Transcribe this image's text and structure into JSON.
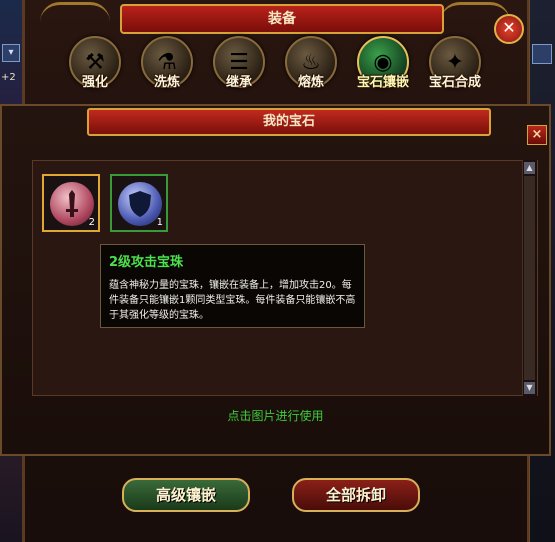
{
  "window": {
    "title": "装备"
  },
  "left_strip": {
    "level_tag": "+2"
  },
  "tabs": [
    {
      "label": "强化",
      "icon": "anvil-icon",
      "glyph": "⚒"
    },
    {
      "label": "洗炼",
      "icon": "cauldron-icon",
      "glyph": "⚗"
    },
    {
      "label": "继承",
      "icon": "scroll-icon",
      "glyph": "☰"
    },
    {
      "label": "熔炼",
      "icon": "furnace-icon",
      "glyph": "♨"
    },
    {
      "label": "宝石镶嵌",
      "icon": "gem-inlay-icon",
      "glyph": "◉"
    },
    {
      "label": "宝石合成",
      "icon": "crystal-icon",
      "glyph": "✦"
    }
  ],
  "active_tab": "宝石镶嵌",
  "dialog": {
    "title": "我的宝石",
    "close_label": "×",
    "gems": [
      {
        "name": "attack-gem",
        "icon": "sword-icon",
        "count": "2",
        "color": "#c05060"
      },
      {
        "name": "defense-gem",
        "icon": "shield-icon",
        "count": "1",
        "color": "#4a5aa8"
      }
    ],
    "tooltip": {
      "title": "2级攻击宝珠",
      "description": "蕴含神秘力量的宝珠，镶嵌在装备上，增加攻击20。每件装备只能镶嵌1颗同类型宝珠。每件装备只能镶嵌不高于其强化等级的宝珠。"
    },
    "hint": "点击图片进行使用"
  },
  "buttons": {
    "advanced_inlay": "高级镶嵌",
    "remove_all": "全部拆卸"
  },
  "colors": {
    "title_red": "#b8221a",
    "gold_border": "#d7a23a",
    "tooltip_title": "#4ce04c",
    "hint_green": "#3ccc3c"
  }
}
